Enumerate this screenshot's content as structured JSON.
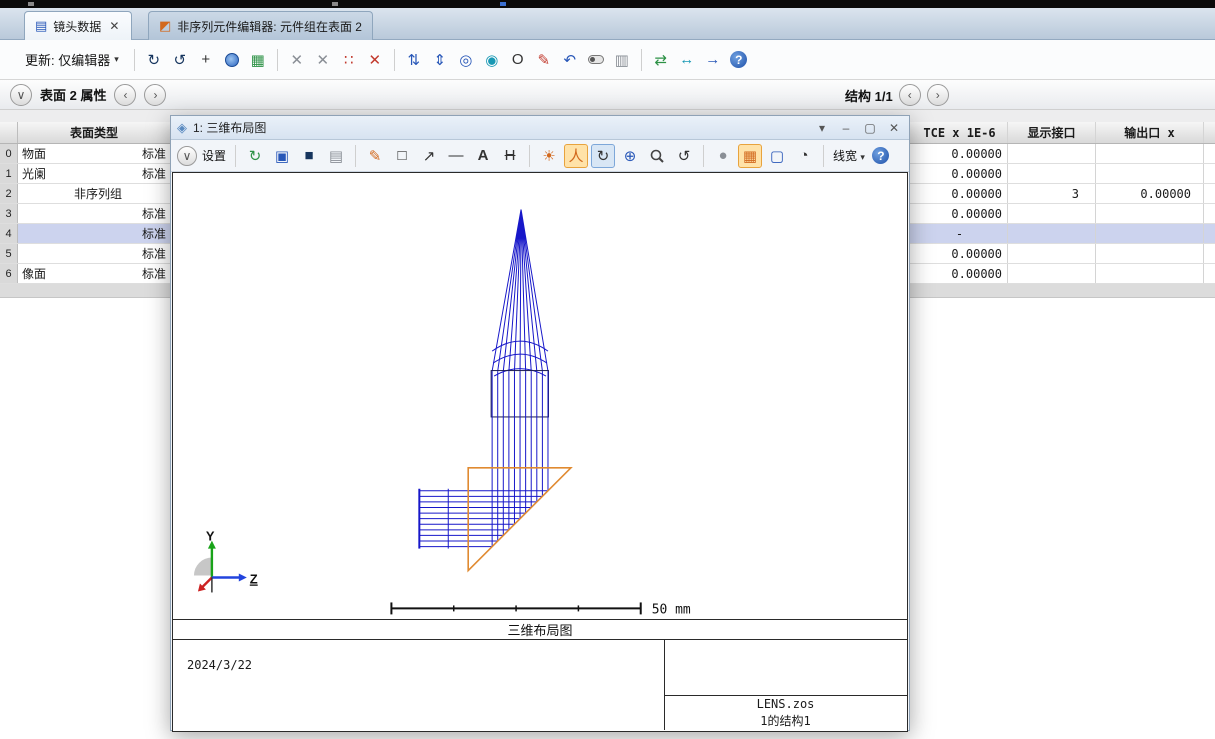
{
  "tabs": {
    "tab1": "镜头数据",
    "tab2": "非序列元件编辑器: 元件组在表面 2"
  },
  "toolbar": {
    "update_label": "更新: 仅编辑器"
  },
  "subtoolbar": {
    "surface_props": "表面 2 属性",
    "config": "结构 1/1"
  },
  "table": {
    "header_left": "表面类型",
    "right_headers": [
      "TCE x 1E-6",
      "显示接口",
      "输出口 x"
    ],
    "rows": [
      {
        "idx": "0",
        "name": "物面",
        "type": "标准",
        "tce": "0.00000",
        "ports": "",
        "exit": ""
      },
      {
        "idx": "1",
        "name": "光阑",
        "type": "标准",
        "tce": "0.00000",
        "ports": "",
        "exit": ""
      },
      {
        "idx": "2",
        "name": "",
        "type": "非序列组",
        "tce": "0.00000",
        "ports": "3",
        "exit": "0.00000"
      },
      {
        "idx": "3",
        "name": "",
        "type": "标准",
        "tce": "0.00000",
        "ports": "",
        "exit": ""
      },
      {
        "idx": "4",
        "name": "",
        "type": "标准",
        "tce": "-",
        "ports": "",
        "exit": ""
      },
      {
        "idx": "5",
        "name": "",
        "type": "标准",
        "tce": "0.00000",
        "ports": "",
        "exit": ""
      },
      {
        "idx": "6",
        "name": "像面",
        "type": "标准",
        "tce": "0.00000",
        "ports": "",
        "exit": ""
      }
    ]
  },
  "window": {
    "title": "1: 三维布局图",
    "settings_label": "设置",
    "linewidth_label": "线宽",
    "scale_label": "50 mm",
    "caption": "三维布局图",
    "date": "2024/3/22",
    "file_name": "LENS.zos",
    "config_name": "1的结构1",
    "axis_y": "Y",
    "axis_z": "Z"
  },
  "icons": {
    "tab_doc": "▤",
    "tab_nsc": "◩",
    "close": "✕",
    "caret": "▾",
    "circle_chevron": "∨",
    "chev_left": "‹",
    "chev_right": "›",
    "sync": "↻",
    "sync2": "↺",
    "crosshair": "+",
    "image": "▦",
    "cut": "✕",
    "dice": "∷",
    "redx": "✕",
    "updown": "⇅",
    "updown2": "⇕",
    "anchor": "◎",
    "globe2": "◉",
    "aperture": "O",
    "pencil_check": "✎",
    "curve": "↶",
    "doc": "▥",
    "recycle": "⇄",
    "lrarrow": "↔",
    "bigarrow": "→",
    "help": "?",
    "refresh": "↻",
    "copy": "▣",
    "save": "■",
    "print": "▤",
    "pencil": "✎",
    "rect": "□",
    "arrow_ne": "↗",
    "line": "—",
    "letterA": "A",
    "dim": "H",
    "rays": "☀",
    "person": "人",
    "orbit": "↻",
    "pan": "⊕",
    "undo": "↺",
    "bulb": "●",
    "grid": "▦",
    "monitor": "▢",
    "clock": "◔",
    "min": "–",
    "max": "▢"
  }
}
